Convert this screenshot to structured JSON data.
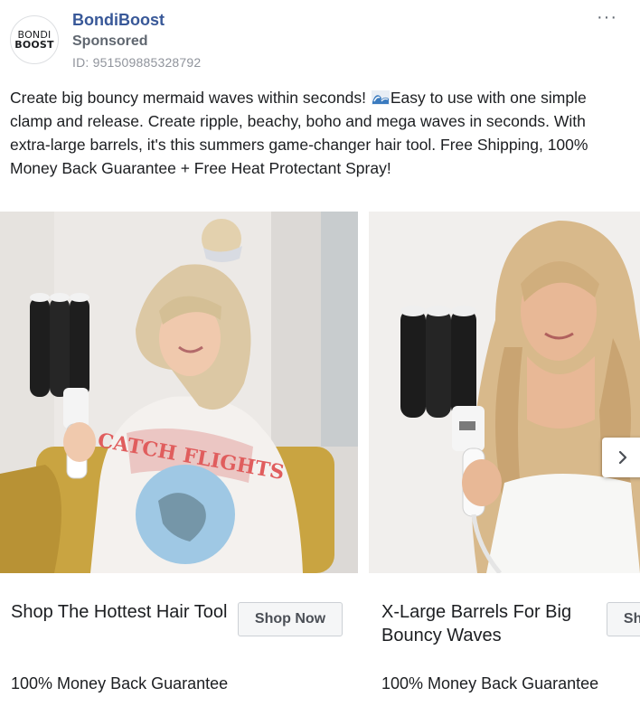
{
  "advertiser": {
    "logo_line1": "BONDI",
    "logo_line2": "BOOST",
    "name": "BondiBoost",
    "sponsored_label": "Sponsored",
    "ad_id": "ID: 951509885328792"
  },
  "menu": {
    "more_label": "···"
  },
  "post": {
    "text_before_emoji": "Create big bouncy mermaid waves within seconds! ",
    "text_after_emoji": "Easy to use with one simple clamp and release. Create ripple, beachy, boho and mega waves in seconds. With extra-large barrels, it's this summers game-changer hair tool. Free Shipping, 100% Money Back Guarantee + Free Heat Protectant Spray!"
  },
  "carousel": {
    "cards": [
      {
        "headline": "Shop The Hottest Hair Tool",
        "cta_label": "Shop Now",
        "description": "100% Money Back Guarantee",
        "shirt_text": "CATCH FLIGHTS"
      },
      {
        "headline": "X-Large Barrels For Big Bouncy Waves",
        "cta_label": "Shop Now",
        "description": "100% Money Back Guarantee"
      }
    ],
    "next_icon": "chevron-right-icon"
  },
  "colors": {
    "brand_blue": "#385898",
    "secondary_text": "#606770",
    "muted_text": "#90949c"
  }
}
